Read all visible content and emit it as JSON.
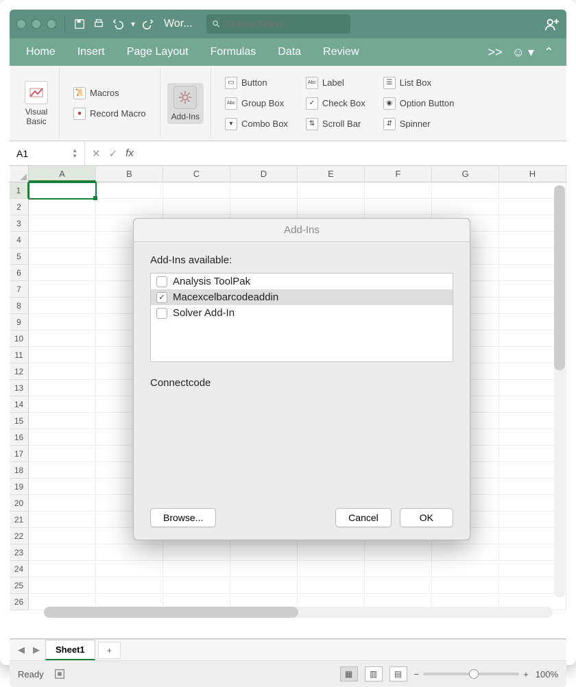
{
  "titlebar": {
    "doc_title": "Wor...",
    "search_placeholder": "Search Sheet"
  },
  "tabs": {
    "items": [
      "Home",
      "Insert",
      "Page Layout",
      "Formulas",
      "Data",
      "Review"
    ],
    "more": ">>"
  },
  "ribbon": {
    "visual_basic": "Visual\nBasic",
    "macros": "Macros",
    "record": "Record Macro",
    "addins": "Add-Ins",
    "controls": {
      "button": "Button",
      "groupbox": "Group Box",
      "combobox": "Combo Box",
      "label": "Label",
      "checkbox": "Check Box",
      "scrollbar": "Scroll Bar",
      "listbox": "List Box",
      "optionbutton": "Option Button",
      "spinner": "Spinner"
    }
  },
  "namebox": {
    "cell": "A1",
    "fx_label": "fx"
  },
  "columns": [
    "A",
    "B",
    "C",
    "D",
    "E",
    "F",
    "G",
    "H"
  ],
  "row_count": 26,
  "sheetbar": {
    "active": "Sheet1",
    "add": "+"
  },
  "status": {
    "ready": "Ready",
    "zoom": "100%"
  },
  "dialog": {
    "title": "Add-Ins",
    "heading": "Add-Ins available:",
    "items": [
      {
        "label": "Analysis ToolPak",
        "checked": false
      },
      {
        "label": "Macexcelbarcodeaddin",
        "checked": true
      },
      {
        "label": "Solver Add-In",
        "checked": false
      }
    ],
    "description": "Connectcode",
    "browse": "Browse...",
    "cancel": "Cancel",
    "ok": "OK"
  }
}
